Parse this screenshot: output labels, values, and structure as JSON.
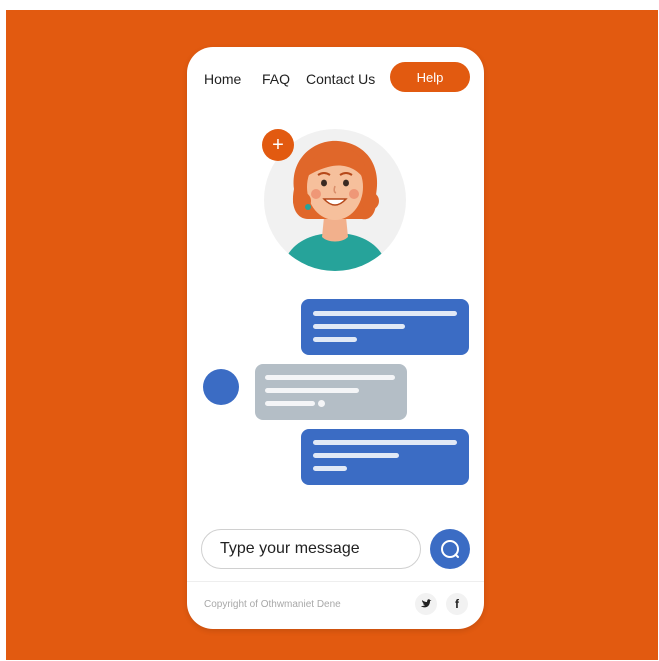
{
  "nav": {
    "home": "Home",
    "faq": "FAQ",
    "contact": "Contact Us",
    "help": "Help"
  },
  "add_button": "+",
  "composer": {
    "placeholder": "Type your message"
  },
  "footer": {
    "copyright": "Copyright of Othwmaniet Dene",
    "social": [
      "twitter-icon",
      "facebook-icon"
    ]
  },
  "colors": {
    "background": "#E25A10",
    "accent": "#E25A10",
    "bubble_outgoing": "#3B6CC4",
    "bubble_incoming": "#B4BEC6",
    "avatar_hair": "#E0672A",
    "avatar_shirt": "#26A39A"
  }
}
